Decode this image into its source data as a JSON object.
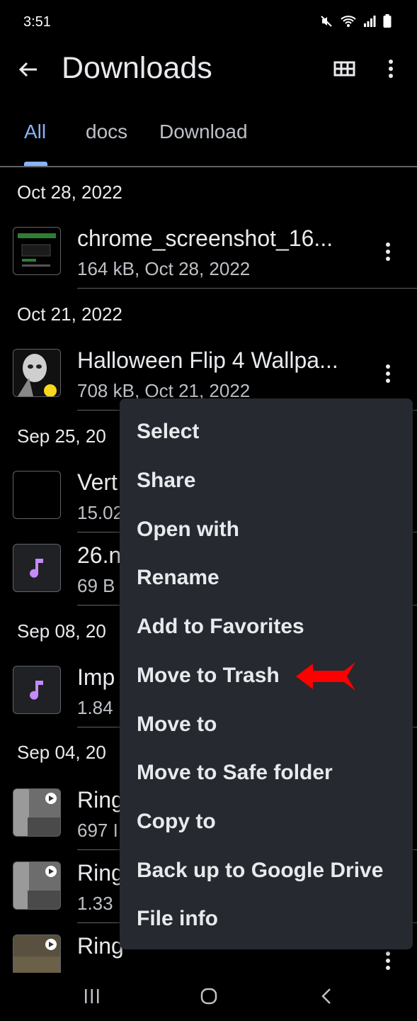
{
  "status_bar": {
    "time": "3:51"
  },
  "app_bar": {
    "title": "Downloads"
  },
  "tabs": [
    {
      "label": "All",
      "active": true
    },
    {
      "label": "docs",
      "active": false
    },
    {
      "label": "Download",
      "active": false
    }
  ],
  "sections": [
    {
      "date": "Oct 28, 2022",
      "files": [
        {
          "name": "chrome_screenshot_16...",
          "meta": "164 kB, Oct 28, 2022",
          "thumb": "screenshot-thumbnail"
        }
      ]
    },
    {
      "date": "Oct 21, 2022",
      "files": [
        {
          "name": "Halloween Flip 4 Wallpa...",
          "meta": "708 kB, Oct 21, 2022",
          "thumb": "wallpaper-thumbnail"
        }
      ]
    },
    {
      "date": "Sep 25, 20",
      "files": [
        {
          "name": "Vert",
          "meta": "15.02",
          "thumb": "blank-thumbnail"
        },
        {
          "name": "26.n",
          "meta": "69 B",
          "thumb": "music-note-icon"
        }
      ]
    },
    {
      "date": "Sep 08, 20",
      "files": [
        {
          "name": "Imp",
          "meta": "1.84",
          "thumb": "music-note-icon"
        }
      ]
    },
    {
      "date": "Sep 04, 20",
      "files": [
        {
          "name": "Ring",
          "meta": "697 I",
          "thumb": "video-thumbnail"
        },
        {
          "name": "Ring",
          "meta": "1.33",
          "thumb": "video-thumbnail"
        },
        {
          "name": "Ring",
          "meta": "",
          "thumb": "video-thumbnail"
        }
      ]
    }
  ],
  "context_menu": {
    "items": [
      "Select",
      "Share",
      "Open with",
      "Rename",
      "Add to Favorites",
      "Move to Trash",
      "Move to",
      "Move to Safe folder",
      "Copy to",
      "Back up to Google Drive",
      "File info"
    ],
    "highlighted": "Move to Trash"
  },
  "colors": {
    "background": "#000000",
    "menu_background": "#26292f",
    "accent": "#8ab4f8",
    "annotation_arrow": "#ff0000",
    "audio_icon": "#c58af9"
  },
  "icons": {
    "back": "arrow-back-icon",
    "grid": "grid-view-icon",
    "more": "more-vert-icon",
    "nav_recents": "recents-icon",
    "nav_home": "home-icon",
    "nav_back": "back-nav-icon"
  }
}
